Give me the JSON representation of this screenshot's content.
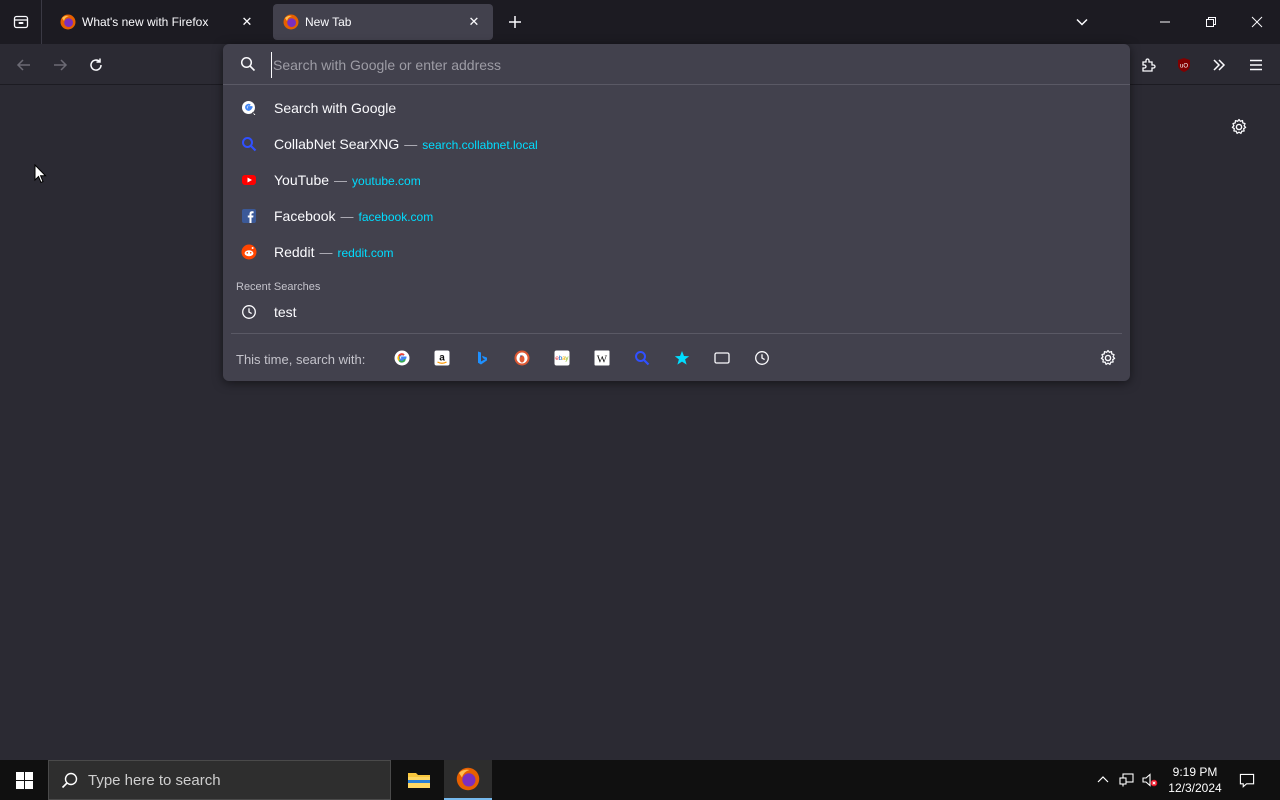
{
  "tabs": [
    {
      "title": "What's new with Firefox",
      "active": false
    },
    {
      "title": "New Tab",
      "active": true
    }
  ],
  "urlbar": {
    "placeholder": "Search with Google or enter address",
    "value": ""
  },
  "results": [
    {
      "icon": "google-search-icon",
      "title": "Search with Google",
      "url": ""
    },
    {
      "icon": "searxng-icon",
      "title": "CollabNet SearXNG",
      "url": "search.collabnet.local"
    },
    {
      "icon": "youtube-icon",
      "title": "YouTube",
      "url": "youtube.com"
    },
    {
      "icon": "facebook-icon",
      "title": "Facebook",
      "url": "facebook.com"
    },
    {
      "icon": "reddit-icon",
      "title": "Reddit",
      "url": "reddit.com"
    }
  ],
  "separator": "—",
  "recent": {
    "header": "Recent Searches",
    "items": [
      {
        "icon": "clock-icon",
        "title": "test"
      }
    ]
  },
  "oneoff": {
    "label": "This time, search with:",
    "engines": [
      "google",
      "amazon",
      "bing",
      "duckduckgo",
      "ebay",
      "wikipedia",
      "searxng",
      "bookmarks",
      "tabs",
      "history"
    ]
  },
  "taskbar": {
    "search_placeholder": "Type here to search",
    "time": "9:19 PM",
    "date": "12/3/2024"
  },
  "colors": {
    "url_accent": "#00ddff",
    "popup_bg": "#42414d",
    "page_bg": "#2b2a33",
    "tabstrip_bg": "#1c1b22"
  }
}
